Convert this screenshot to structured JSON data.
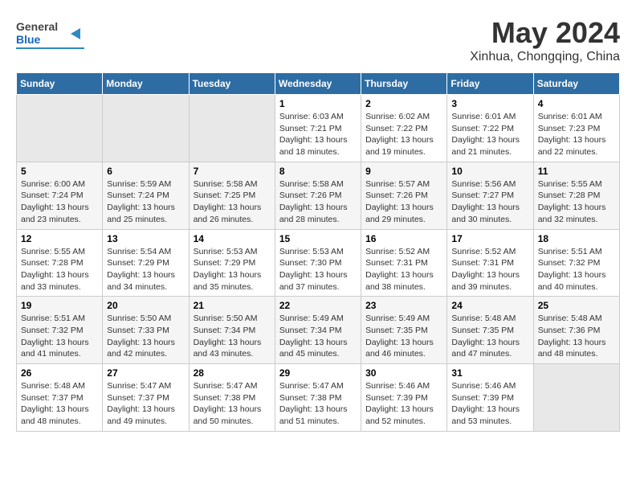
{
  "logo": {
    "line1": "General",
    "line2": "Blue"
  },
  "title": "May 2024",
  "subtitle": "Xinhua, Chongqing, China",
  "days_header": [
    "Sunday",
    "Monday",
    "Tuesday",
    "Wednesday",
    "Thursday",
    "Friday",
    "Saturday"
  ],
  "weeks": [
    [
      {
        "day": "",
        "info": ""
      },
      {
        "day": "",
        "info": ""
      },
      {
        "day": "",
        "info": ""
      },
      {
        "day": "1",
        "info": "Sunrise: 6:03 AM\nSunset: 7:21 PM\nDaylight: 13 hours and 18 minutes."
      },
      {
        "day": "2",
        "info": "Sunrise: 6:02 AM\nSunset: 7:22 PM\nDaylight: 13 hours and 19 minutes."
      },
      {
        "day": "3",
        "info": "Sunrise: 6:01 AM\nSunset: 7:22 PM\nDaylight: 13 hours and 21 minutes."
      },
      {
        "day": "4",
        "info": "Sunrise: 6:01 AM\nSunset: 7:23 PM\nDaylight: 13 hours and 22 minutes."
      }
    ],
    [
      {
        "day": "5",
        "info": "Sunrise: 6:00 AM\nSunset: 7:24 PM\nDaylight: 13 hours and 23 minutes."
      },
      {
        "day": "6",
        "info": "Sunrise: 5:59 AM\nSunset: 7:24 PM\nDaylight: 13 hours and 25 minutes."
      },
      {
        "day": "7",
        "info": "Sunrise: 5:58 AM\nSunset: 7:25 PM\nDaylight: 13 hours and 26 minutes."
      },
      {
        "day": "8",
        "info": "Sunrise: 5:58 AM\nSunset: 7:26 PM\nDaylight: 13 hours and 28 minutes."
      },
      {
        "day": "9",
        "info": "Sunrise: 5:57 AM\nSunset: 7:26 PM\nDaylight: 13 hours and 29 minutes."
      },
      {
        "day": "10",
        "info": "Sunrise: 5:56 AM\nSunset: 7:27 PM\nDaylight: 13 hours and 30 minutes."
      },
      {
        "day": "11",
        "info": "Sunrise: 5:55 AM\nSunset: 7:28 PM\nDaylight: 13 hours and 32 minutes."
      }
    ],
    [
      {
        "day": "12",
        "info": "Sunrise: 5:55 AM\nSunset: 7:28 PM\nDaylight: 13 hours and 33 minutes."
      },
      {
        "day": "13",
        "info": "Sunrise: 5:54 AM\nSunset: 7:29 PM\nDaylight: 13 hours and 34 minutes."
      },
      {
        "day": "14",
        "info": "Sunrise: 5:53 AM\nSunset: 7:29 PM\nDaylight: 13 hours and 35 minutes."
      },
      {
        "day": "15",
        "info": "Sunrise: 5:53 AM\nSunset: 7:30 PM\nDaylight: 13 hours and 37 minutes."
      },
      {
        "day": "16",
        "info": "Sunrise: 5:52 AM\nSunset: 7:31 PM\nDaylight: 13 hours and 38 minutes."
      },
      {
        "day": "17",
        "info": "Sunrise: 5:52 AM\nSunset: 7:31 PM\nDaylight: 13 hours and 39 minutes."
      },
      {
        "day": "18",
        "info": "Sunrise: 5:51 AM\nSunset: 7:32 PM\nDaylight: 13 hours and 40 minutes."
      }
    ],
    [
      {
        "day": "19",
        "info": "Sunrise: 5:51 AM\nSunset: 7:32 PM\nDaylight: 13 hours and 41 minutes."
      },
      {
        "day": "20",
        "info": "Sunrise: 5:50 AM\nSunset: 7:33 PM\nDaylight: 13 hours and 42 minutes."
      },
      {
        "day": "21",
        "info": "Sunrise: 5:50 AM\nSunset: 7:34 PM\nDaylight: 13 hours and 43 minutes."
      },
      {
        "day": "22",
        "info": "Sunrise: 5:49 AM\nSunset: 7:34 PM\nDaylight: 13 hours and 45 minutes."
      },
      {
        "day": "23",
        "info": "Sunrise: 5:49 AM\nSunset: 7:35 PM\nDaylight: 13 hours and 46 minutes."
      },
      {
        "day": "24",
        "info": "Sunrise: 5:48 AM\nSunset: 7:35 PM\nDaylight: 13 hours and 47 minutes."
      },
      {
        "day": "25",
        "info": "Sunrise: 5:48 AM\nSunset: 7:36 PM\nDaylight: 13 hours and 48 minutes."
      }
    ],
    [
      {
        "day": "26",
        "info": "Sunrise: 5:48 AM\nSunset: 7:37 PM\nDaylight: 13 hours and 48 minutes."
      },
      {
        "day": "27",
        "info": "Sunrise: 5:47 AM\nSunset: 7:37 PM\nDaylight: 13 hours and 49 minutes."
      },
      {
        "day": "28",
        "info": "Sunrise: 5:47 AM\nSunset: 7:38 PM\nDaylight: 13 hours and 50 minutes."
      },
      {
        "day": "29",
        "info": "Sunrise: 5:47 AM\nSunset: 7:38 PM\nDaylight: 13 hours and 51 minutes."
      },
      {
        "day": "30",
        "info": "Sunrise: 5:46 AM\nSunset: 7:39 PM\nDaylight: 13 hours and 52 minutes."
      },
      {
        "day": "31",
        "info": "Sunrise: 5:46 AM\nSunset: 7:39 PM\nDaylight: 13 hours and 53 minutes."
      },
      {
        "day": "",
        "info": ""
      }
    ]
  ]
}
